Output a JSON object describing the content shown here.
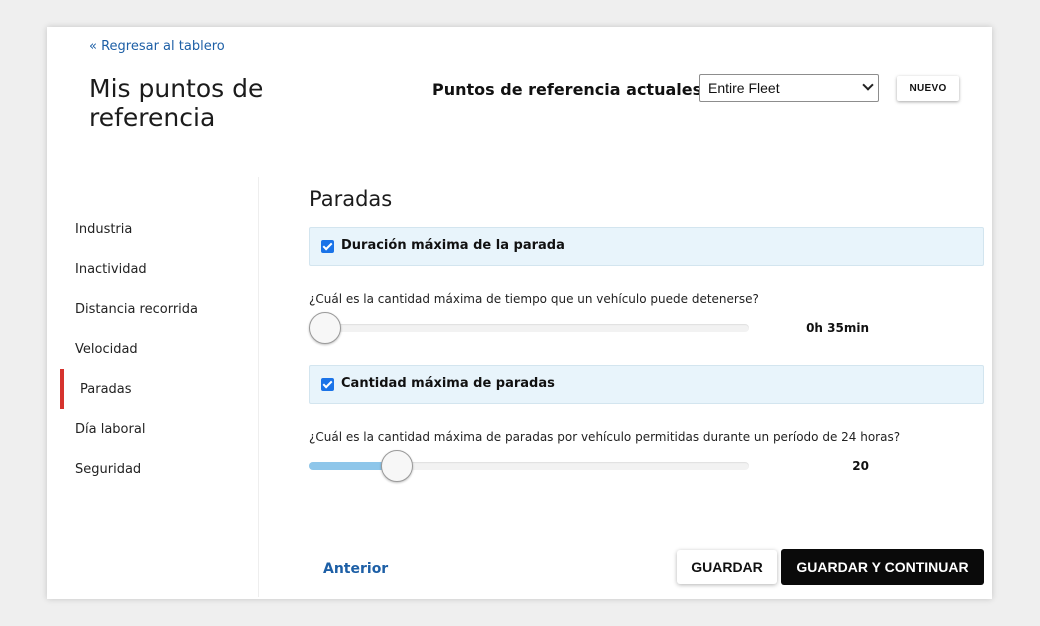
{
  "header": {
    "back_link": "« Regresar al tablero",
    "title": "Mis puntos de referencia",
    "current_label": "Puntos de referencia actuales :",
    "current_value": "Entire Fleet",
    "new_button": "NUEVO"
  },
  "sidebar": {
    "items": [
      {
        "label": "Industria"
      },
      {
        "label": "Inactividad"
      },
      {
        "label": "Distancia recorrida"
      },
      {
        "label": "Velocidad"
      },
      {
        "label": "Paradas"
      },
      {
        "label": "Día laboral"
      },
      {
        "label": "Seguridad"
      }
    ],
    "active_index": 4,
    "active_color": "#d6332e"
  },
  "main": {
    "section_title": "Paradas",
    "options": [
      {
        "label": "Duración máxima de la parada",
        "checked": true,
        "question": "¿Cuál es la cantidad máxima de tiempo que un vehículo  puede detenerse?",
        "value": "0h 35min",
        "slider_fraction": 0.0
      },
      {
        "label": "Cantidad máxima de paradas",
        "checked": true,
        "question": "¿Cuál es la cantidad máxima de paradas por vehículo permitidas durante un período de 24 horas?",
        "value": "20",
        "slider_fraction": 0.2
      }
    ]
  },
  "footer": {
    "previous": "Anterior",
    "save": "GUARDAR",
    "save_continue": "GUARDAR Y CONTINUAR"
  },
  "colors": {
    "link": "#1d5fa6",
    "option_bg": "#e8f4fb",
    "slider_fill": "#8ec6ea",
    "checkbox": "#1a73e8",
    "primary_button": "#0a0a0a"
  }
}
